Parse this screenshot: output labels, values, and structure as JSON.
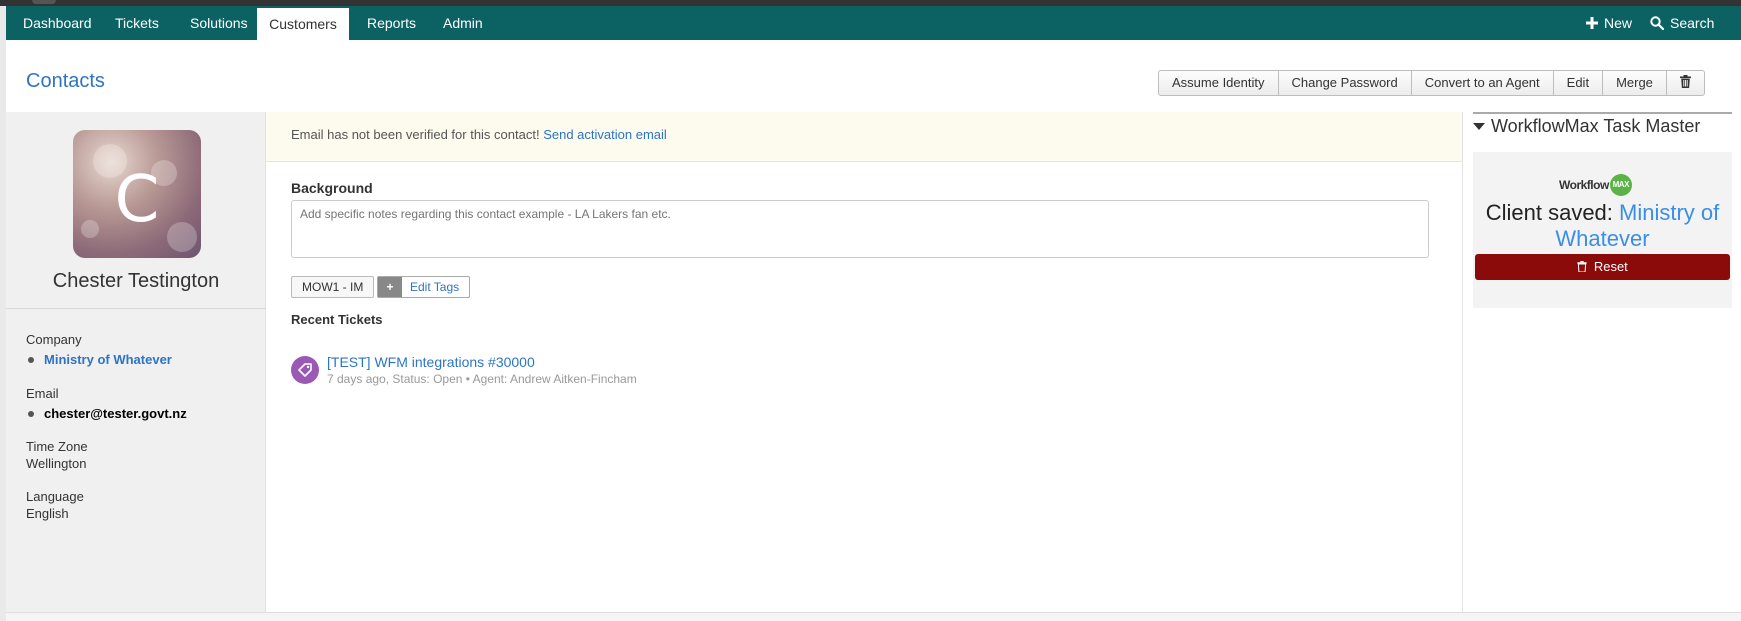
{
  "nav": {
    "tabs": [
      {
        "label": "Dashboard"
      },
      {
        "label": "Tickets"
      },
      {
        "label": "Solutions"
      },
      {
        "label": "Customers"
      },
      {
        "label": "Reports"
      },
      {
        "label": "Admin"
      }
    ],
    "new_label": "New",
    "search_label": "Search"
  },
  "header": {
    "title": "Contacts",
    "buttons": [
      "Assume Identity",
      "Change Password",
      "Convert to an Agent",
      "Edit",
      "Merge"
    ]
  },
  "contact": {
    "avatar_letter": "C",
    "name": "Chester Testington",
    "company_label": "Company",
    "company": "Ministry of Whatever",
    "email_label": "Email",
    "email": "chester@tester.govt.nz",
    "timezone_label": "Time Zone",
    "timezone": "Wellington",
    "language_label": "Language",
    "language": "English"
  },
  "alert": {
    "text": "Email has not been verified for this contact!",
    "link": "Send activation email"
  },
  "background": {
    "heading": "Background",
    "placeholder": "Add specific notes regarding this contact example - LA Lakers fan etc."
  },
  "tags": {
    "items": [
      "MOW1 - IM"
    ],
    "plus": "+",
    "edit_label": "Edit Tags"
  },
  "recent_tickets": {
    "heading": "Recent Tickets",
    "items": [
      {
        "title": "[TEST] WFM integrations #30000",
        "meta": "7 days ago, Status: Open  •  Agent: Andrew Aitken-Fincham"
      }
    ]
  },
  "widget": {
    "title": "WorkflowMax Task Master",
    "logo_text": "Workflow",
    "logo_badge": "MAX",
    "saved_prefix": "Client saved:",
    "saved_name": "Ministry of Whatever",
    "reset_label": "Reset"
  },
  "colors": {
    "nav_bg": "#0c6262",
    "link": "#2d74c4",
    "reset_bg": "#8b0a0a",
    "ticket_icon": "#9b59b6",
    "wfm_badge": "#5bb346"
  }
}
